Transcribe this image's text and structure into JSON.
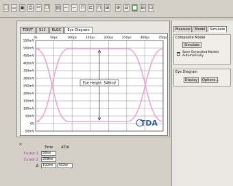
{
  "toolbar": {
    "icons": [
      "new-icon",
      "open-icon",
      "save-icon",
      "print-icon",
      "cut-icon",
      "copy-icon",
      "paste-icon",
      "wire-icon",
      "probe-icon",
      "measure-icon",
      "cursor-icon",
      "zoom-icon",
      "grid-icon",
      "run-icon",
      "stop-icon",
      "green-run-icon",
      "settings-icon",
      "layout-icon"
    ]
  },
  "left_tabs": [
    "TDR/T",
    "S11",
    "RLGC",
    "Eye Diagram"
  ],
  "eye_plot": {
    "x_ticks": [
      "0s",
      "50ps",
      "100ps",
      "150ps",
      "200ps",
      "250ps",
      "300ps",
      "350ps"
    ],
    "y_ticks": [
      "550mV",
      "500mV",
      "450mV",
      "400mV",
      "350mV",
      "300mV",
      "250mV",
      "200mV",
      "150mV",
      "100mV",
      "50mV",
      "0V",
      "-50mV"
    ],
    "eye_height_label": "Eye Height: 548mV",
    "logo": "TDA"
  },
  "cursors": {
    "header_time": "Time",
    "header_delta": "ΔT/Δ",
    "rows": [
      {
        "label": "Cursor 1",
        "value": "58ns",
        "delta": ""
      },
      {
        "label": "Cursor 2",
        "value": "258ns",
        "delta": ""
      },
      {
        "label": "Δ",
        "value": "192ns",
        "delta": "5Ghz"
      }
    ]
  },
  "right_tabs": [
    "Measure",
    "Model",
    "Simulate"
  ],
  "composite_model": {
    "title": "Composite Model",
    "simulate_button": "Simulate",
    "checkbox_label": "Save Generated Models Automatically",
    "checked": true
  },
  "eye_diagram": {
    "title": "Eye Diagram",
    "display_button": "Display",
    "options_button": "Options..."
  },
  "colors": {
    "eye_trace": "#e6a6d6",
    "grid": "#6b6b6b",
    "logo": "#2b5aa8",
    "cursor_label": "#9a2ab0"
  }
}
